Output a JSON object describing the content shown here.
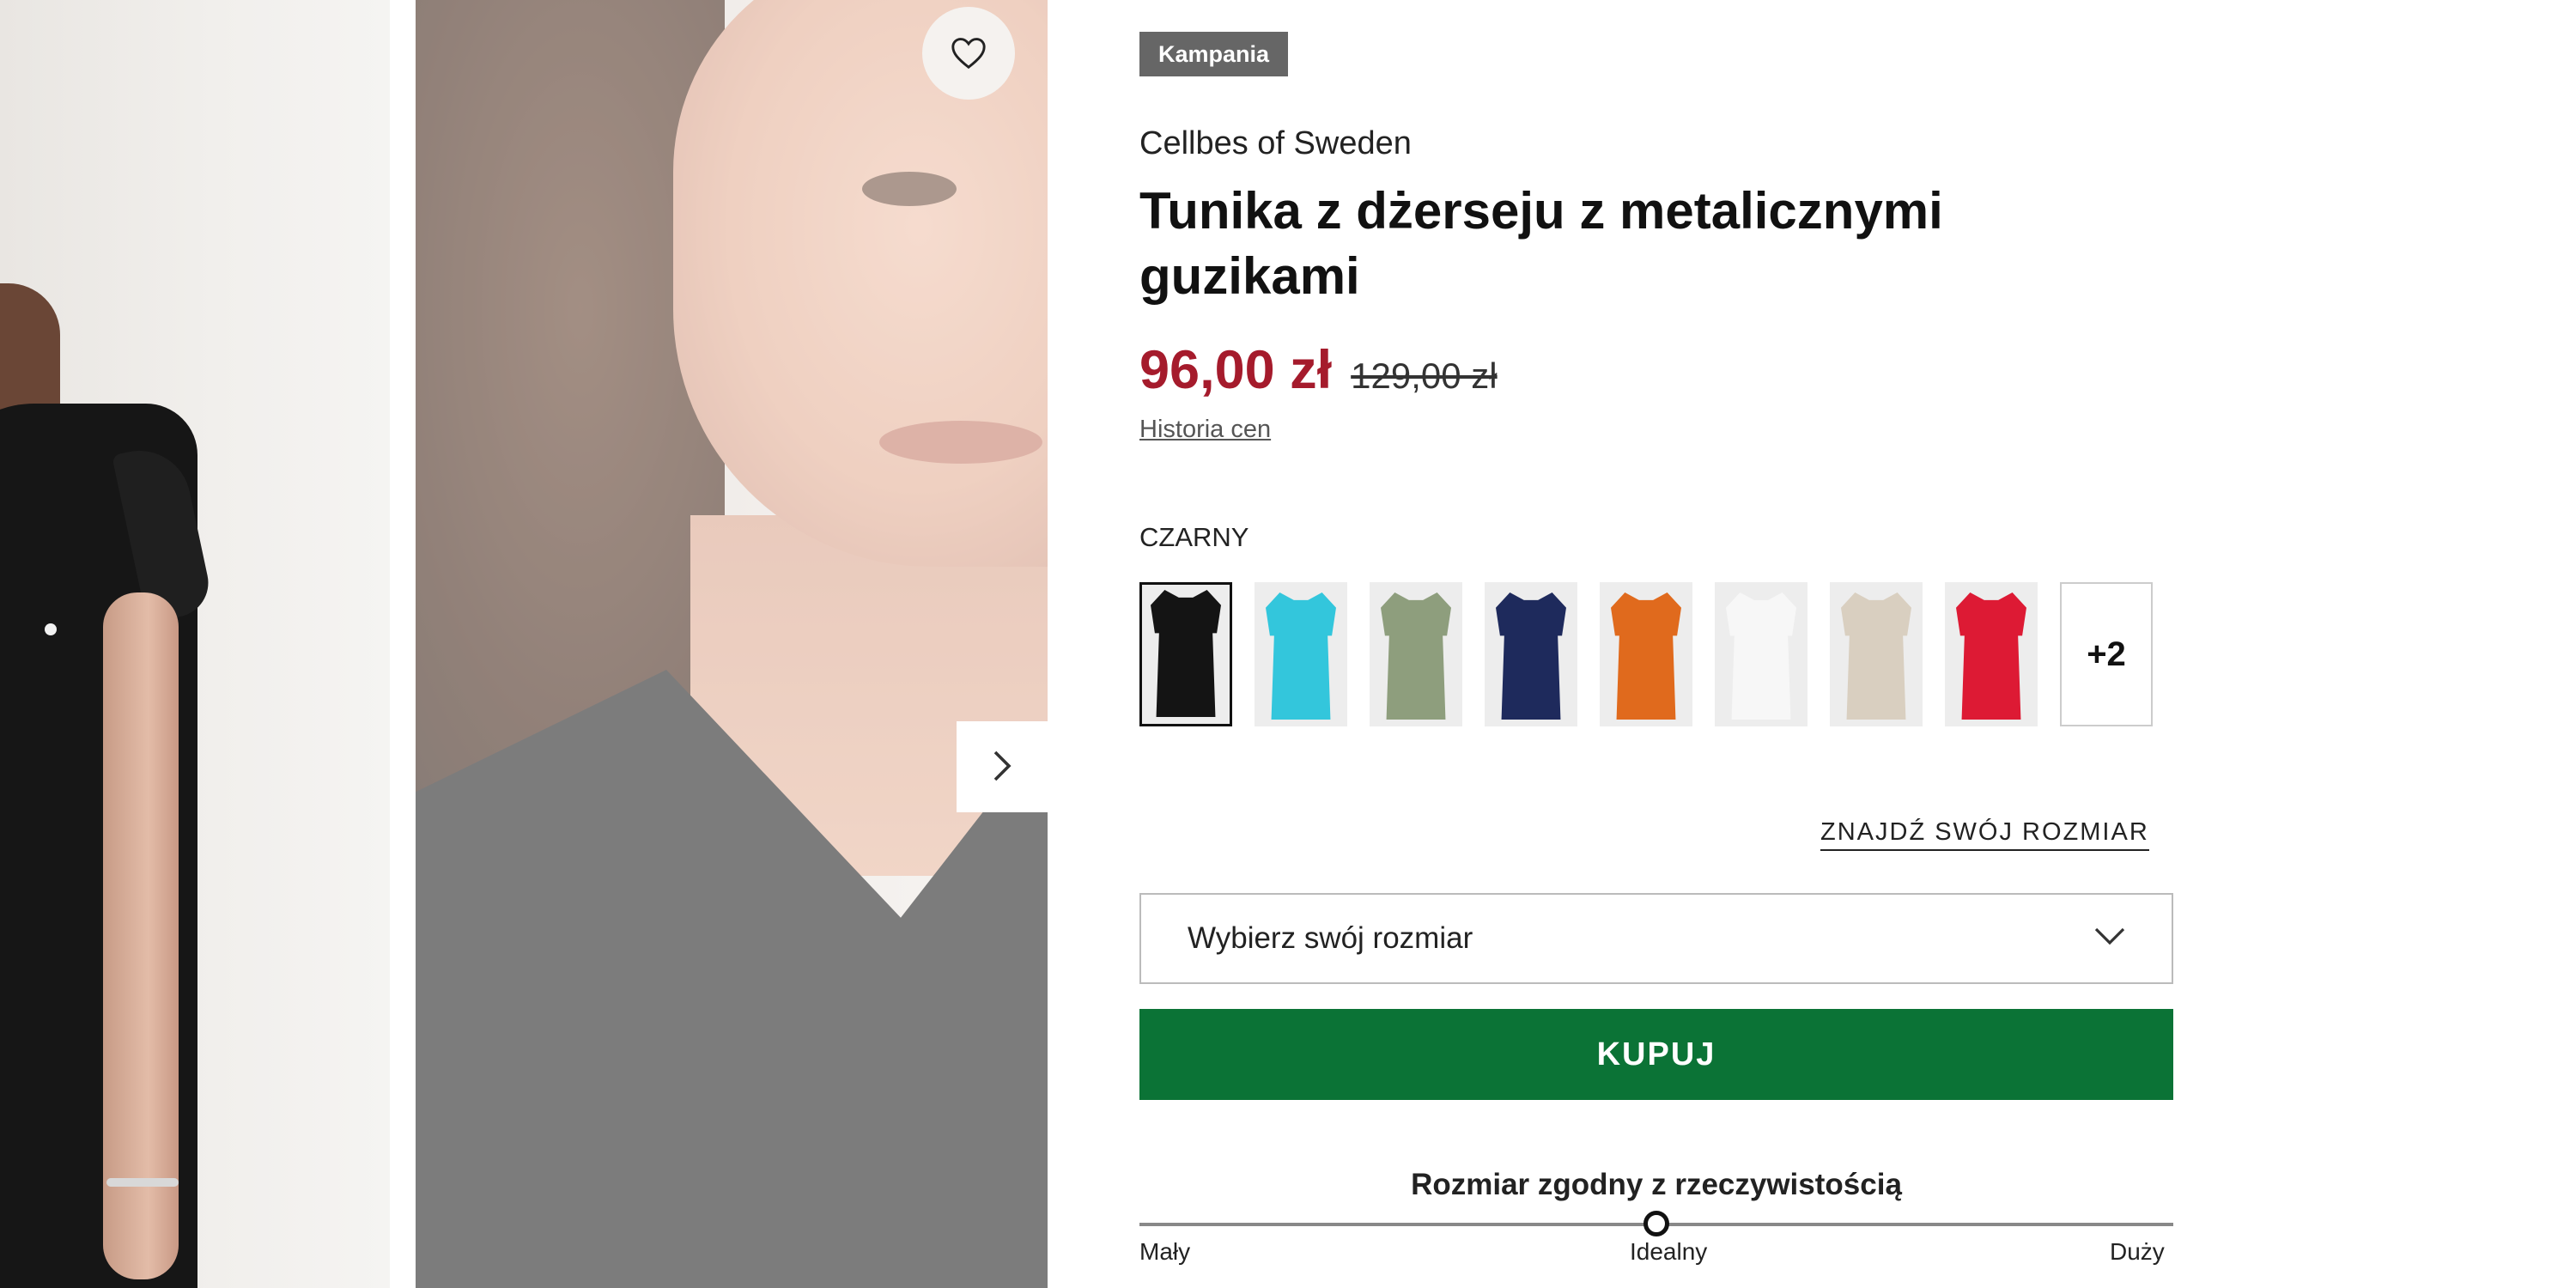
{
  "gallery": {
    "favorite_icon": "heart-outline-icon",
    "next_icon": "chevron-right-icon"
  },
  "product": {
    "badge": "Kampania",
    "brand": "Cellbes of Sweden",
    "title": "Tunika z dżerseju z metalicznymi guzikami",
    "price_current": "96,00 zł",
    "price_original": "129,00 zł",
    "price_history_link": "Historia cen",
    "price_color": "#a51b2c"
  },
  "colors": {
    "selected_label": "CZARNY",
    "swatches": [
      {
        "name": "czarny",
        "hex": "#141414",
        "selected": true
      },
      {
        "name": "turkus",
        "hex": "#33c6dc",
        "selected": false
      },
      {
        "name": "oliwkowy",
        "hex": "#8e9e7d",
        "selected": false
      },
      {
        "name": "granatowy",
        "hex": "#1e2a5c",
        "selected": false
      },
      {
        "name": "pomarańczowy",
        "hex": "#e06a1d",
        "selected": false
      },
      {
        "name": "biały",
        "hex": "#f7f7f7",
        "selected": false
      },
      {
        "name": "beżowy",
        "hex": "#d9cfc0",
        "selected": false
      },
      {
        "name": "czerwony",
        "hex": "#dd1a34",
        "selected": false
      }
    ],
    "more_label": "+2"
  },
  "size": {
    "find_size_link": "ZNAJDŹ SWÓJ ROZMIAR",
    "select_placeholder": "Wybierz swój rozmiar",
    "select_icon": "chevron-down-icon"
  },
  "buy": {
    "label": "KUPUJ",
    "color": "#0b7336"
  },
  "fit": {
    "title": "Rozmiar zgodny z rzeczywistością",
    "labels": [
      "Mały",
      "Idealny",
      "Duży"
    ],
    "value": 0.5
  }
}
